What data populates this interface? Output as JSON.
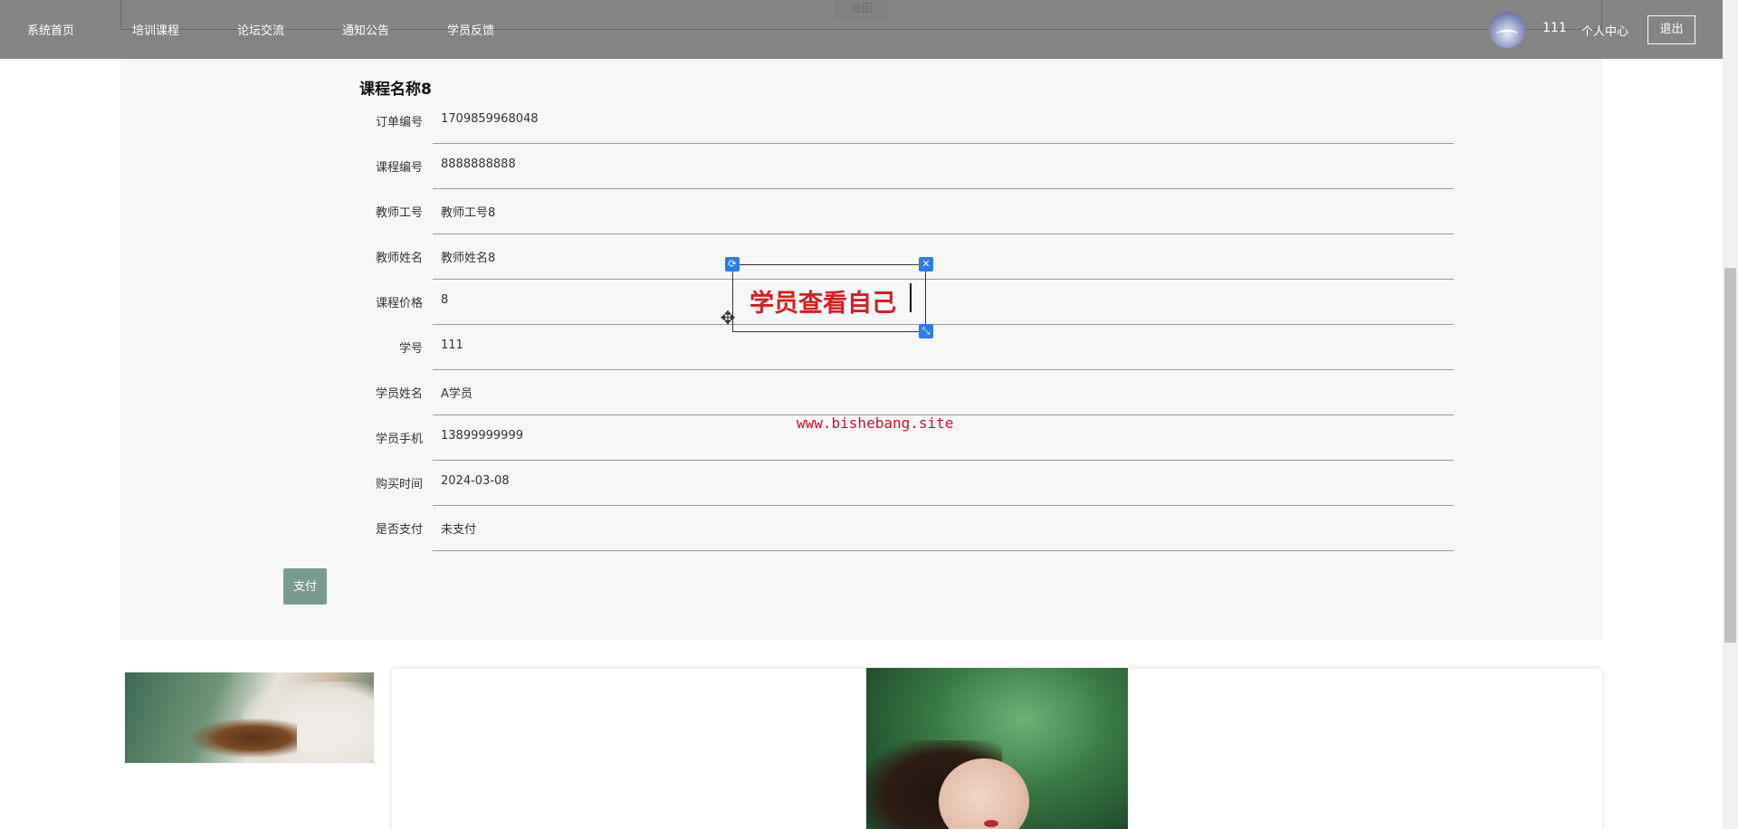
{
  "nav": {
    "items": [
      "系统首页",
      "培训课程",
      "论坛交流",
      "通知公告",
      "学员反馈"
    ],
    "username": "111",
    "user_center": "个人中心",
    "logout": "退出"
  },
  "back_label": "返回",
  "course_title": "课程名称8",
  "fields": [
    {
      "label": "订单编号",
      "value": "1709859968048"
    },
    {
      "label": "课程编号",
      "value": "8888888888"
    },
    {
      "label": "教师工号",
      "value": "教师工号8"
    },
    {
      "label": "教师姓名",
      "value": "教师姓名8"
    },
    {
      "label": "课程价格",
      "value": "8"
    },
    {
      "label": "学号",
      "value": "111"
    },
    {
      "label": "学员姓名",
      "value": "A学员"
    },
    {
      "label": "学员手机",
      "value": "13899999999"
    },
    {
      "label": "购买时间",
      "value": "2024-03-08"
    },
    {
      "label": "是否支付",
      "value": "未支付"
    }
  ],
  "pay_button": "支付",
  "annotation_text": "学员查看自己",
  "watermark": "www.bishebang.site",
  "colors": {
    "nav_bg": "#6e6e6e",
    "pay_button": "#7a9b92",
    "annotation": "#d42020",
    "watermark": "#c8102e",
    "handle": "#2f7de1"
  }
}
